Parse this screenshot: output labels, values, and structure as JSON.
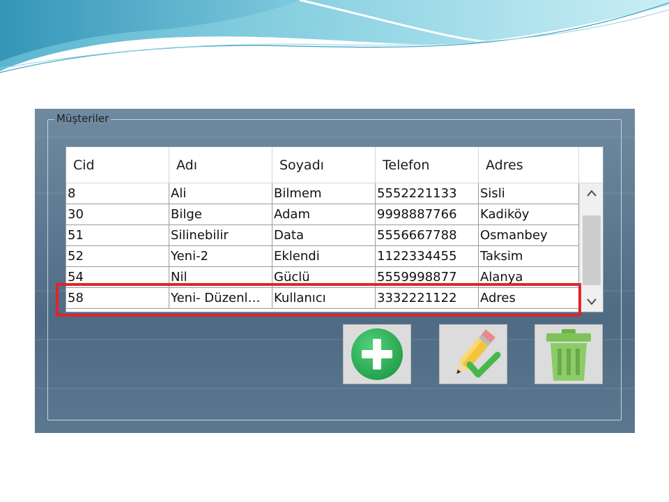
{
  "window": {
    "group_title": "Müşteriler"
  },
  "grid": {
    "columns": [
      "Cid",
      "Adı",
      "Soyadı",
      "Telefon",
      "Adres"
    ],
    "rows": [
      [
        "8",
        "Ali",
        "Bilmem",
        "5552221133",
        "Sisli"
      ],
      [
        "30",
        "Bilge",
        "Adam",
        "9998887766",
        "Kadiköy"
      ],
      [
        "51",
        "Silinebilir",
        "Data",
        "5556667788",
        "Osmanbey"
      ],
      [
        "52",
        "Yeni-2",
        "Eklendi",
        "1122334455",
        "Taksim"
      ],
      [
        "54",
        "Nil",
        "Güclü",
        "5559998877",
        "Alanya"
      ],
      [
        "58",
        "Yeni- Düzenl…",
        "Kullanıcı",
        "3332221122",
        "Adres"
      ]
    ],
    "highlighted_row": 5,
    "scroll_up_icon": "chevron-up-icon",
    "scroll_down_icon": "chevron-down-icon"
  },
  "actions": {
    "add_icon": "plus-circle-icon",
    "edit_icon": "pencil-check-icon",
    "delete_icon": "trash-icon"
  },
  "colors": {
    "highlight": "#e0242b",
    "add_green": "#2fb35a",
    "delete_green": "#7fc25a"
  }
}
